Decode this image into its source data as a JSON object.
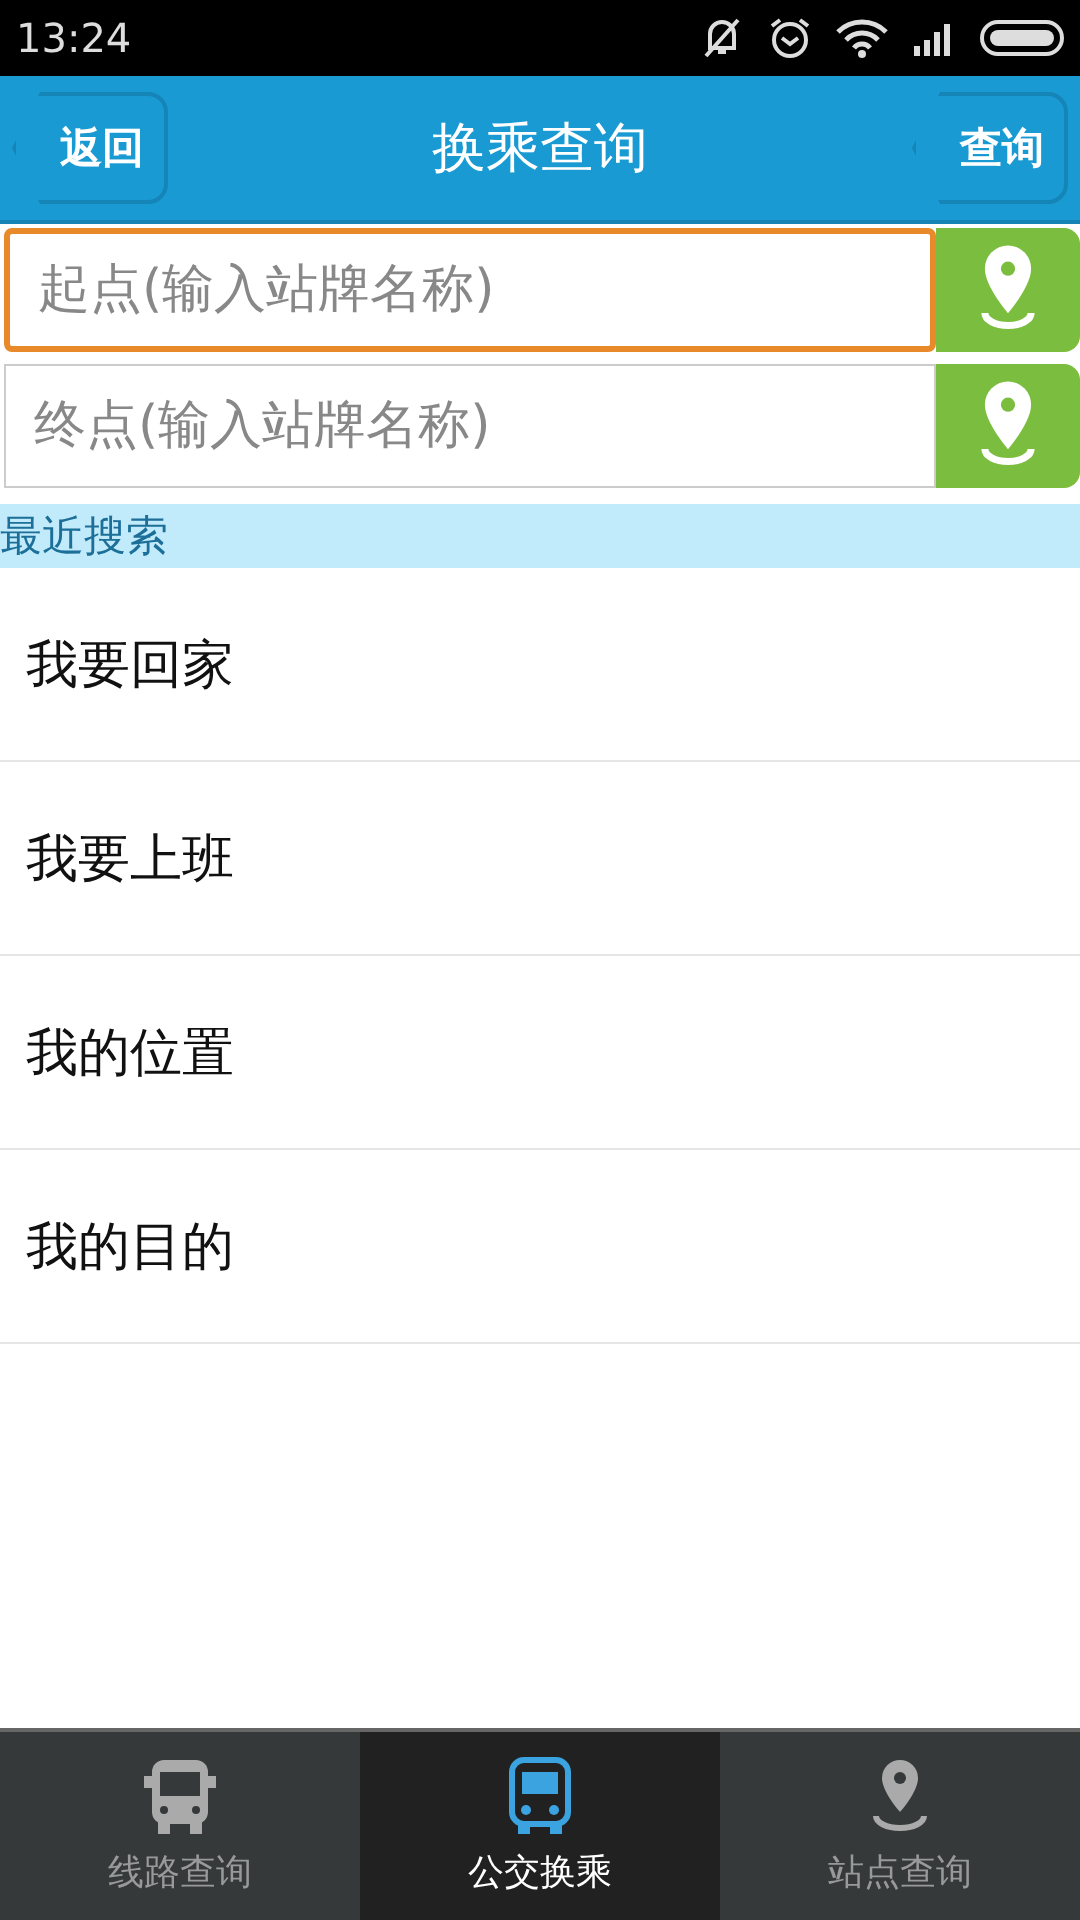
{
  "status_bar": {
    "time": "13:24"
  },
  "header": {
    "back": "返回",
    "title": "换乘查询",
    "action": "查询"
  },
  "fields": [
    {
      "placeholder": "起点(输入站牌名称)",
      "focused": true
    },
    {
      "placeholder": "终点(输入站牌名称)",
      "focused": false
    }
  ],
  "recent": {
    "title": "最近搜索",
    "items": [
      "我要回家",
      "我要上班",
      "我的位置",
      "我的目的"
    ]
  },
  "tabs": [
    {
      "label": "线路查询",
      "kind": "bus",
      "selected": false
    },
    {
      "label": "公交换乘",
      "kind": "transfer",
      "selected": true
    },
    {
      "label": "站点查询",
      "kind": "pin",
      "selected": false
    }
  ]
}
